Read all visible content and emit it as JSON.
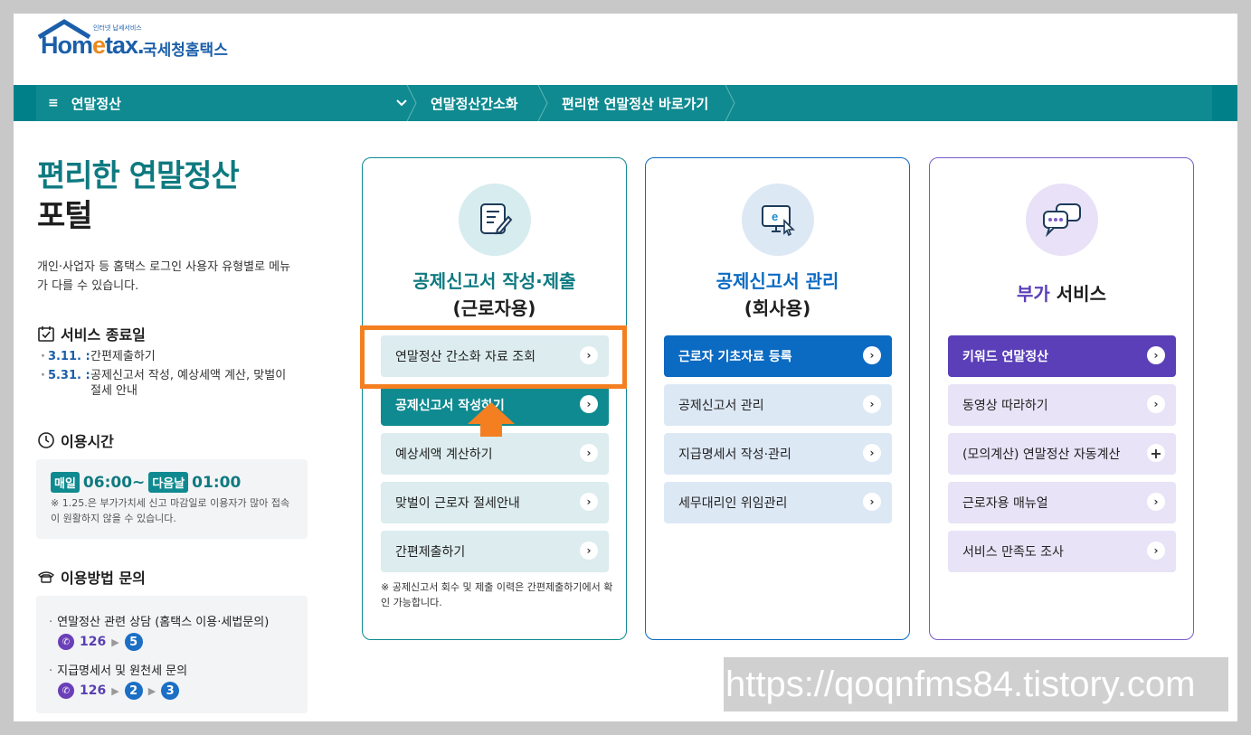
{
  "logo": {
    "tagline": "인터넷 납세서비스",
    "brand_pre": "Hom",
    "brand_e": "e",
    "brand_post": "tax.",
    "korean": "국세청홈택스"
  },
  "nav": {
    "menu_icon": "≡",
    "menu_label": "연말정산",
    "crumb1": "연말정산간소화",
    "crumb2": "편리한 연말정산 바로가기"
  },
  "left": {
    "title_line1": "편리한 연말정산",
    "title_line2": "포털",
    "desc": "개인·사업자 등 홈택스 로그인 사용자 유형별로 메뉴가 다를 수 있습니다.",
    "end_heading": "서비스 종료일",
    "end_items": [
      {
        "date": "3.11. :",
        "text": "간편제출하기"
      },
      {
        "date": "5.31. :",
        "text": "공제신고서 작성, 예상세액 계산, 맞벌이 절세 안내"
      }
    ],
    "time_heading": "이용시간",
    "time_badge1": "매일",
    "time_start": "06:00~",
    "time_badge2": "다음날",
    "time_end": "01:00",
    "time_note": "※ 1.25.은 부가가치세 신고 마감일로 이용자가 많아 접속이 원활하지 않을 수 있습니다.",
    "inquiry_heading": "이용방법 문의",
    "inquiry1": "연말정산 관련 상담 (홈택스 이용·세법문의)",
    "inquiry1_phone": "126",
    "inquiry1_n1": "5",
    "inquiry2": "지급명세서 및 원천세 문의",
    "inquiry2_phone": "126",
    "inquiry2_n1": "2",
    "inquiry2_n2": "3"
  },
  "cards": [
    {
      "title": "공제신고서 작성·제출",
      "subtitle": "(근로자용)",
      "buttons": [
        "연말정산 간소화 자료 조회",
        "공제신고서 작성하기",
        "예상세액 계산하기",
        "맞벌이 근로자 절세안내",
        "간편제출하기"
      ],
      "note": "※ 공제신고서 회수 및 제출 이력은 간편제출하기에서 확인 가능합니다."
    },
    {
      "title": "공제신고서 관리",
      "subtitle": "(회사용)",
      "buttons": [
        "근로자 기초자료 등록",
        "공제신고서 관리",
        "지급명세서 작성·관리",
        "세무대리인 위임관리"
      ]
    },
    {
      "title_a": "부가",
      "title_b": " 서비스",
      "buttons": [
        "키워드 연말정산",
        "동영상 따라하기",
        "(모의계산) 연말정산 자동계산",
        "근로자용 매뉴얼",
        "서비스 만족도 조사"
      ]
    }
  ],
  "watermark": "https://qoqnfms84.tistory.com",
  "colors": {
    "teal": "#0e8a90",
    "blue": "#0b6ac2",
    "purple": "#5a3fb8",
    "highlight": "#f47f21"
  }
}
